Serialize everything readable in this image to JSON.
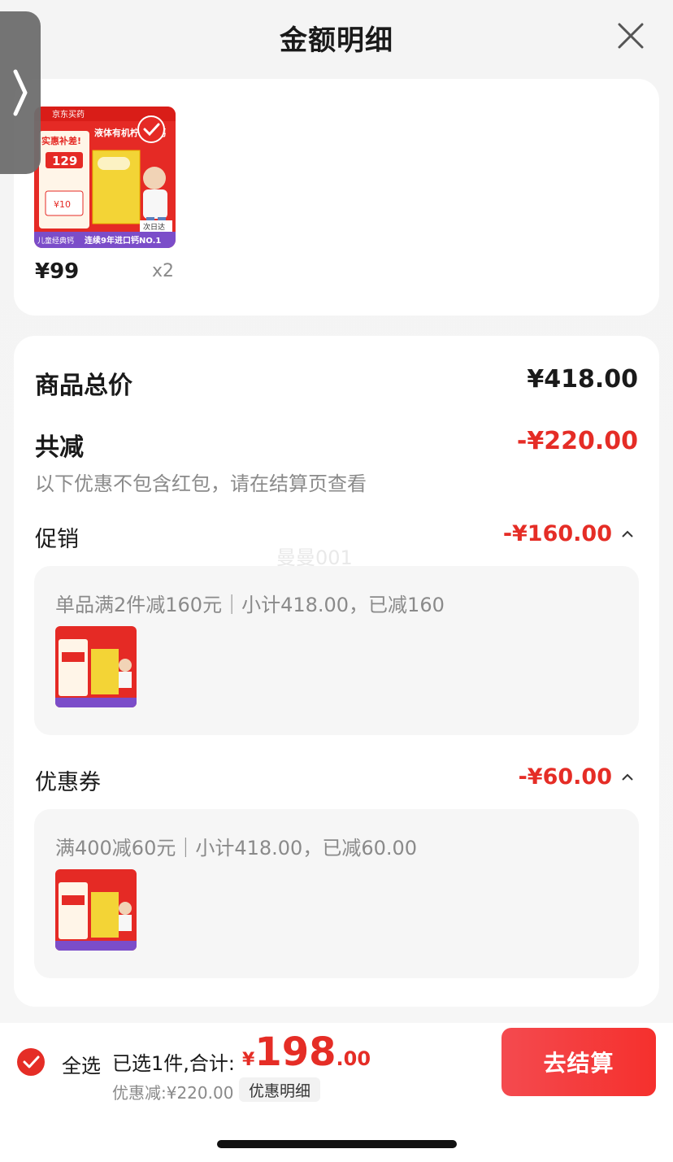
{
  "header": {
    "title": "金额明细"
  },
  "product": {
    "image_text": {
      "brand": "京东买药",
      "headline": "液体有机柠檬酸钙",
      "promo": "实惠补差!",
      "price_tag": "129",
      "coupon": "¥10",
      "badge": "次日达",
      "footer": "连续9年进口钙NO.1",
      "footer_left": "儿童经典钙"
    },
    "price": "¥99",
    "qty": "x2"
  },
  "summary": {
    "total_label": "商品总价",
    "total_value": "¥418.00",
    "discount_label": "共减",
    "discount_value": "-¥220.00",
    "note": "以下优惠不包含红包，请在结算页查看"
  },
  "promotion": {
    "label": "促销",
    "value": "-¥160.00",
    "detail": "单品满2件减160元｜小计418.00，已减160"
  },
  "coupon": {
    "label": "优惠券",
    "value": "-¥60.00",
    "detail": "满400减60元｜小计418.00，已减60.00"
  },
  "watermark": "曼曼001",
  "footer": {
    "select_all": "全选",
    "selected_text": "已选1件,合计:",
    "currency": "¥",
    "amount_int": "198",
    "amount_dec": ".00",
    "discount_text": "优惠减:¥220.00",
    "discount_detail_btn": "优惠明细",
    "checkout_btn": "去结算"
  },
  "colors": {
    "accent": "#e52d26",
    "button": "#f5302d"
  },
  "icons": {
    "close": "close-icon",
    "chevron_right": "chevron-right-icon",
    "check": "check-circle-icon",
    "chevron_up": "chevron-up-icon"
  }
}
